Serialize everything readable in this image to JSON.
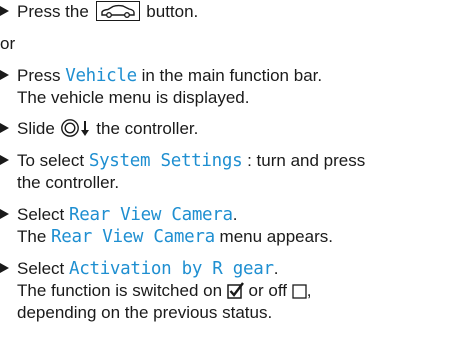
{
  "steps": {
    "s1": {
      "before": "Press the",
      "icon": "car-button-icon",
      "after": "button."
    },
    "or": "or",
    "s2": {
      "before": "Press",
      "hl": "Vehicle",
      "after": "in the main function bar.",
      "line2": "The vehicle menu is displayed."
    },
    "s3": {
      "before": "Slide",
      "icon": "controller-slide-down-icon",
      "after": "the controller."
    },
    "s4": {
      "before": "To select",
      "hl": "System Settings",
      "after": ": turn and press",
      "line2": "the controller."
    },
    "s5": {
      "before": "Select",
      "hl": "Rear View Camera",
      "after": ".",
      "line2_before": "The",
      "line2_hl": "Rear View Camera",
      "line2_after": "menu appears."
    },
    "s6": {
      "before": "Select",
      "hl": "Activation by R gear",
      "after": ".",
      "line2_before": "The function is switched on",
      "on_icon": "checked-box-icon",
      "line2_mid": "or off",
      "off_icon": "empty-box-icon",
      "line2_after": ",",
      "line3": "depending on the previous status."
    }
  },
  "colors": {
    "highlight": "#1f8fd1",
    "text": "#1a1a1a"
  }
}
